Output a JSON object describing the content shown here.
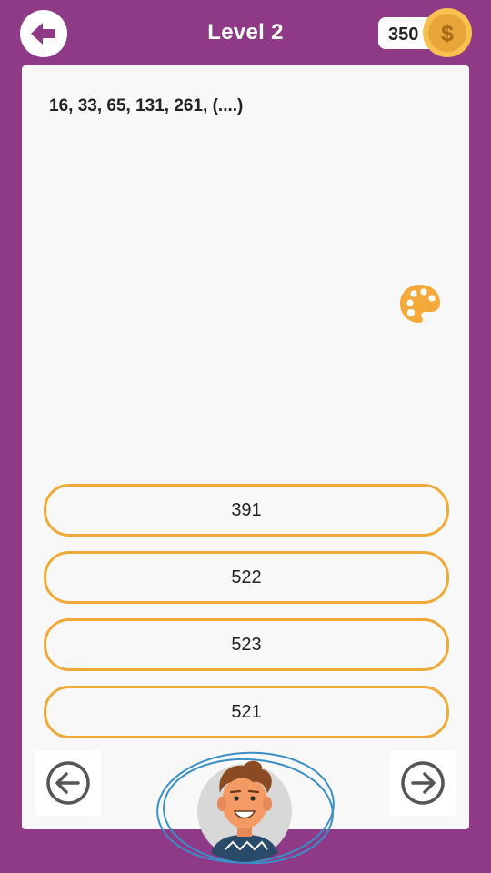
{
  "header": {
    "back_icon": "back-arrow-icon",
    "title": "Level 2",
    "coins": "350",
    "coin_icon": "dollar-coin-icon"
  },
  "question": {
    "text": "16, 33, 65, 131, 261, (....)",
    "palette_icon": "palette-icon"
  },
  "answers": [
    {
      "label": "391"
    },
    {
      "label": "522"
    },
    {
      "label": "523"
    },
    {
      "label": "521"
    }
  ],
  "navigation": {
    "prev_icon": "arrow-left-circle-icon",
    "next_icon": "arrow-right-circle-icon",
    "hint_avatar": "man-avatar"
  },
  "colors": {
    "background": "#8e3a86",
    "card": "#f8f8f8",
    "answer_border": "#f0aa3a",
    "coin": "#f0aa3a",
    "avatar_ring": "#3a8fc7"
  }
}
